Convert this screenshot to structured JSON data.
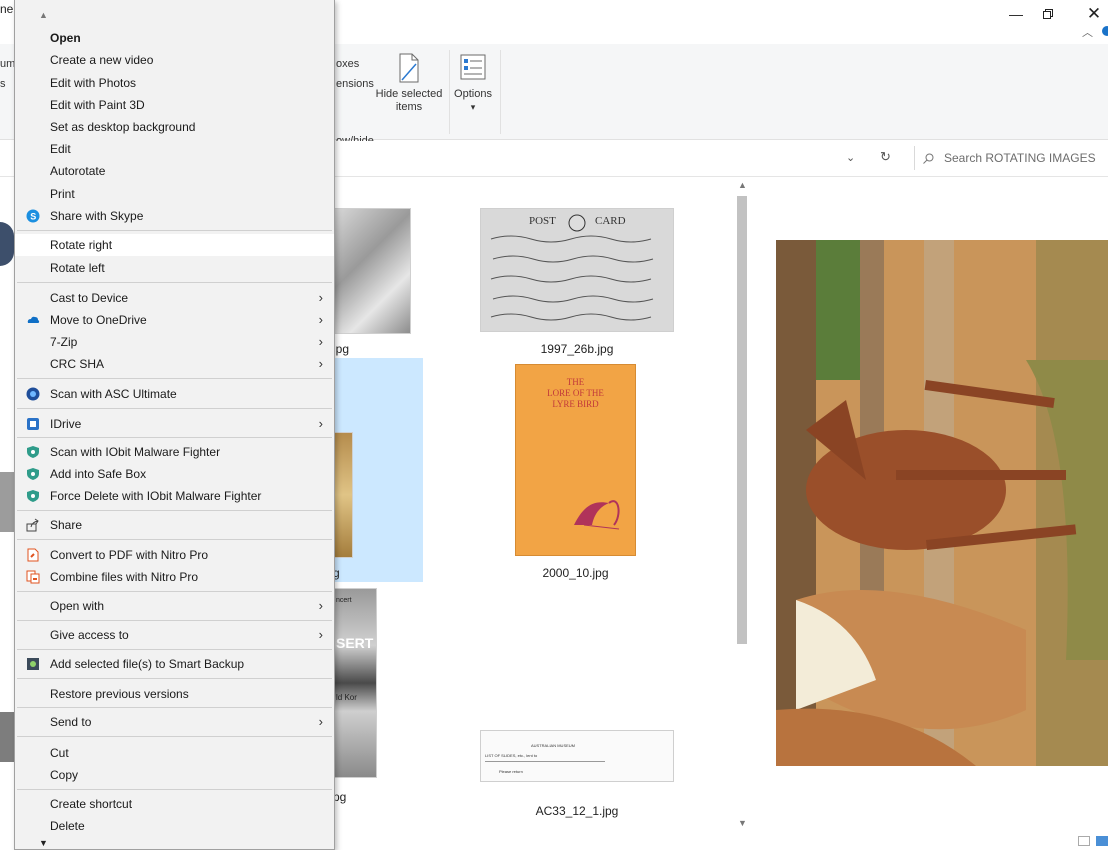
{
  "window": {
    "title_fragment": "ne",
    "ribbon_texts": [
      "um",
      "s",
      "oxes",
      "ensions",
      "ow/hide"
    ],
    "hide_selected_label": "Hide selected items",
    "options_label": "Options",
    "options_caret": "▾"
  },
  "search": {
    "placeholder": "Search ROTATING IMAGES"
  },
  "files": [
    {
      "name": "jpg"
    },
    {
      "name": "1997_26b.jpg"
    },
    {
      "name": "g"
    },
    {
      "name": "2000_10.jpg"
    },
    {
      "name": "pg"
    },
    {
      "name": "AC33_12_1.jpg"
    }
  ],
  "postcard_text": {
    "post": "POST",
    "card": "CARD"
  },
  "book_cover": {
    "title_line1": "THE",
    "title_line2": "LORE OF THE",
    "title_line3": "LYRE BIRD"
  },
  "poster_text": {
    "top": "ncert",
    "mid": "SERT",
    "sub": "ld Kor"
  },
  "document_text": {
    "header": "AUSTRALIAN MUSEUM",
    "line1": "LIST OF SLIDES, etc., lent to",
    "line2": "Please return"
  },
  "context_menu": {
    "items": [
      {
        "label": "Open",
        "bold": true
      },
      {
        "label": "Create a new video"
      },
      {
        "label": "Edit with Photos"
      },
      {
        "label": "Edit with Paint 3D"
      },
      {
        "label": "Set as desktop background"
      },
      {
        "label": "Edit"
      },
      {
        "label": "Autorotate"
      },
      {
        "label": "Print"
      },
      {
        "label": "Share with Skype",
        "icon": "skype-icon"
      },
      {
        "label": "Rotate right",
        "highlighted": true
      },
      {
        "label": "Rotate left"
      },
      {
        "label": "Cast to Device",
        "submenu": true
      },
      {
        "label": "Move to OneDrive",
        "icon": "onedrive-icon",
        "submenu": true
      },
      {
        "label": "7-Zip",
        "submenu": true
      },
      {
        "label": "CRC SHA",
        "submenu": true
      },
      {
        "label": "Scan with ASC Ultimate",
        "icon": "asc-icon"
      },
      {
        "label": "IDrive",
        "icon": "idrive-icon",
        "submenu": true
      },
      {
        "label": "Scan with IObit Malware Fighter",
        "icon": "iobit-icon"
      },
      {
        "label": "Add into Safe Box",
        "icon": "iobit-icon"
      },
      {
        "label": "Force Delete with IObit Malware Fighter",
        "icon": "iobit-icon"
      },
      {
        "label": "Share",
        "icon": "share-icon"
      },
      {
        "label": "Convert to PDF with Nitro Pro",
        "icon": "nitro-icon"
      },
      {
        "label": "Combine files with Nitro Pro",
        "icon": "nitro-combine-icon"
      },
      {
        "label": "Open with",
        "submenu": true
      },
      {
        "label": "Give access to",
        "submenu": true
      },
      {
        "label": "Add selected file(s) to Smart Backup",
        "icon": "smart-backup-icon"
      },
      {
        "label": "Restore previous versions"
      },
      {
        "label": "Send to",
        "submenu": true
      },
      {
        "label": "Cut"
      },
      {
        "label": "Copy"
      },
      {
        "label": "Create shortcut"
      },
      {
        "label": "Delete"
      }
    ]
  }
}
